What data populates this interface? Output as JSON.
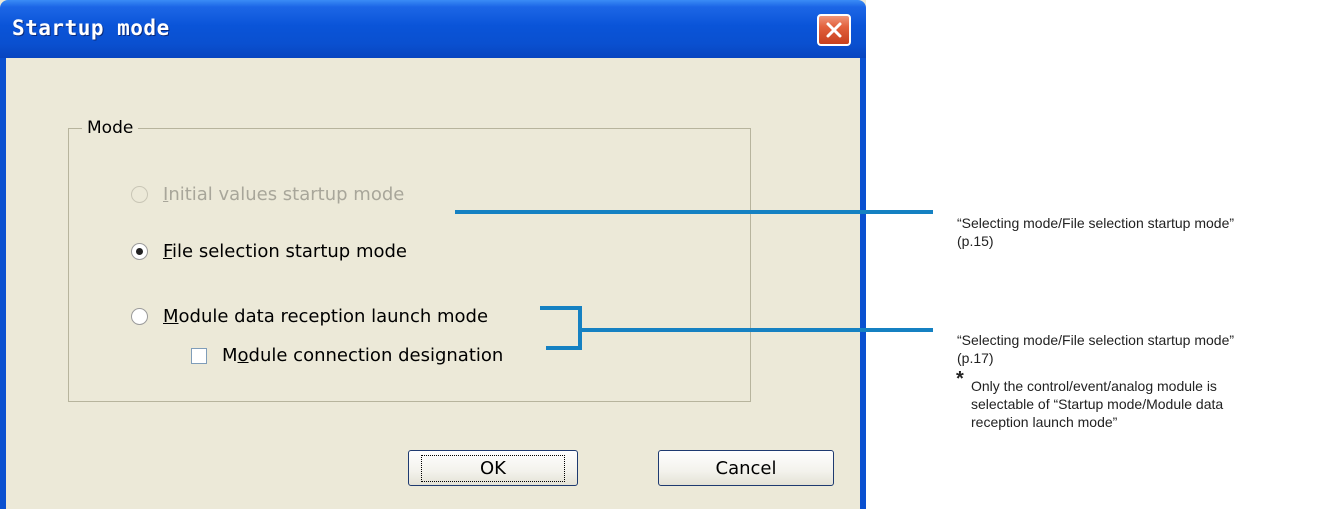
{
  "dialog": {
    "title": "Startup mode",
    "group_label": "Mode",
    "options": [
      {
        "label_underline": "I",
        "label_rest": "nitial values startup mode"
      },
      {
        "label_underline": "F",
        "label_rest": "ile selection startup mode"
      },
      {
        "label_underline": "M",
        "label_rest": "odule data reception launch mode"
      }
    ],
    "checkbox": {
      "label_pre": "M",
      "label_underline": "o",
      "label_rest": "dule connection designation"
    },
    "ok_label": "OK",
    "cancel_label": "Cancel"
  },
  "annotations": {
    "note1_line1": "“Selecting mode/File selection startup mode”",
    "note1_line2": "(p.15)",
    "note2_line1": "“Selecting mode/File selection startup mode”",
    "note2_line2": "(p.17)",
    "star": "*",
    "footnote_line1": "Only the control/event/analog module is",
    "footnote_line2": "selectable of “Startup mode/Module data",
    "footnote_line3": "reception launch mode”"
  },
  "colors": {
    "title_bar": "#0a50d0",
    "dialog_bg": "#ece9d8",
    "callout": "#1581c2",
    "close_button": "#e2603c"
  },
  "icons": {
    "close": "close-icon"
  }
}
